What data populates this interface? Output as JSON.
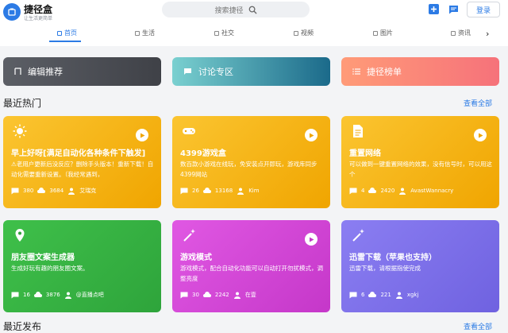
{
  "header": {
    "logo_title": "捷径盒",
    "logo_sub": "让生活更简单",
    "search_placeholder": "搜索捷径",
    "login_label": "登录"
  },
  "nav": {
    "items": [
      {
        "label": "首页",
        "active": true
      },
      {
        "label": "生活"
      },
      {
        "label": "社交"
      },
      {
        "label": "视频"
      },
      {
        "label": "图片"
      },
      {
        "label": "资讯"
      }
    ],
    "more_arrow": "›"
  },
  "categories": [
    {
      "label": "编辑推荐"
    },
    {
      "label": "讨论专区"
    },
    {
      "label": "捷径榜单"
    }
  ],
  "hot": {
    "title": "最近热门",
    "see_all": "查看全部",
    "cards": [
      {
        "icon": "sun-icon",
        "title": "早上好呀[满足自动化各种条件下触发]",
        "desc": "⚠老用户更新后没反应？删除手头版本！重新下载！自动化需要重新设置。（我经常遇到，",
        "comments": "380",
        "downloads": "3684",
        "author": "艾瑞克",
        "color": "#f7b91e"
      },
      {
        "icon": "gamepad-icon",
        "title": "4399游戏盒",
        "desc": "数百款小游戏在线玩，免安装点开即玩，游戏库同步4399网站",
        "comments": "26",
        "downloads": "13168",
        "author": "Kim",
        "color": "#f7b91e"
      },
      {
        "icon": "document-icon",
        "title": "重置网络",
        "desc": "可以做到一键重置网络的效果，没有信号时，可以用这个",
        "comments": "4",
        "downloads": "2420",
        "author": "AvastWannacry",
        "color": "#f7b91e"
      },
      {
        "icon": "location-pin-icon",
        "title": "朋友圈文案生成器",
        "desc": "生成好玩有趣的朋友圈文案。",
        "comments": "16",
        "downloads": "3876",
        "author": "@直播点吧",
        "color": "#38b544"
      },
      {
        "icon": "magic-wand-icon",
        "title": "游戏模式",
        "desc": "游戏模式，配合自动化功能可以自动打开勿扰模式，调整亮度",
        "comments": "30",
        "downloads": "2242",
        "author": "在壹",
        "color": "#d447d8"
      },
      {
        "icon": "magic-wand-icon",
        "title": "迅雷下载（苹果也支持）",
        "desc": "迅雷下载，请根据指使完成",
        "comments": "6",
        "downloads": "221",
        "author": "xgkj",
        "color": "#7d70ea"
      }
    ]
  },
  "latest": {
    "title": "最近发布",
    "see_all": "查看全部"
  },
  "colors": {
    "accent": "#2c7be5"
  }
}
